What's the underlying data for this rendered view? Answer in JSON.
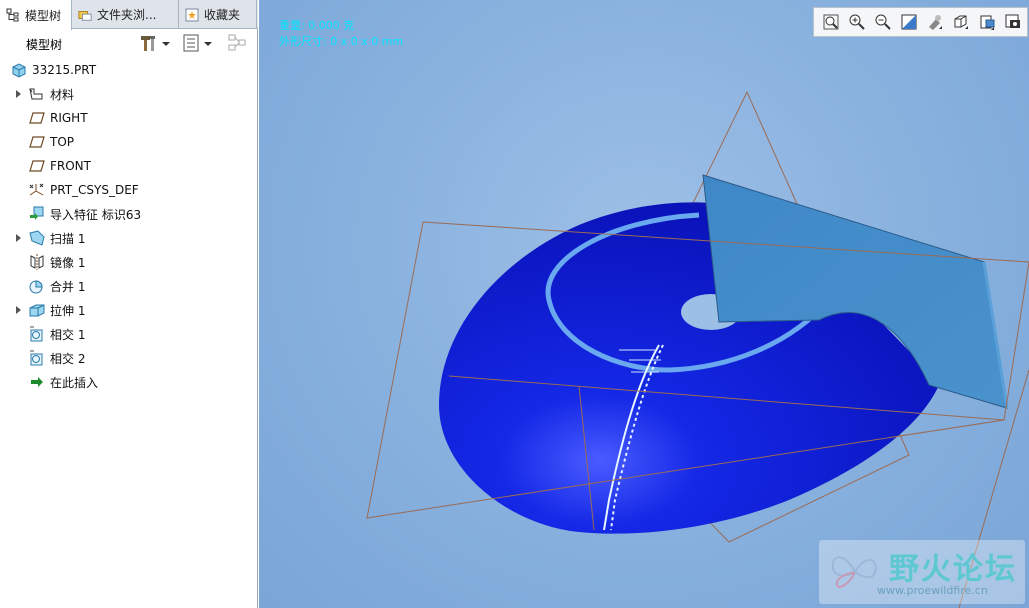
{
  "tabs": [
    {
      "label": "模型树",
      "icon": "tree-icon"
    },
    {
      "label": "文件夹浏...",
      "icon": "folder-browser-icon"
    },
    {
      "label": "收藏夹",
      "icon": "favorites-icon"
    }
  ],
  "tree_toolbar": {
    "title": "模型树"
  },
  "tree": {
    "root": {
      "label": "33215.PRT",
      "icon": "part-icon"
    },
    "items": [
      {
        "label": "材料",
        "icon": "material-icon",
        "expandable": true
      },
      {
        "label": "RIGHT",
        "icon": "datum-plane-icon",
        "expandable": false
      },
      {
        "label": "TOP",
        "icon": "datum-plane-icon",
        "expandable": false
      },
      {
        "label": "FRONT",
        "icon": "datum-plane-icon",
        "expandable": false
      },
      {
        "label": "PRT_CSYS_DEF",
        "icon": "csys-icon",
        "expandable": false
      },
      {
        "label": "导入特征 标识63",
        "icon": "import-feature-icon",
        "expandable": false
      },
      {
        "label": "扫描 1",
        "icon": "sweep-icon",
        "expandable": true
      },
      {
        "label": "镜像 1",
        "icon": "mirror-icon",
        "expandable": false
      },
      {
        "label": "合并 1",
        "icon": "merge-icon",
        "expandable": false
      },
      {
        "label": "拉伸 1",
        "icon": "extrude-icon",
        "expandable": true
      },
      {
        "label": "相交 1",
        "icon": "intersect-icon",
        "expandable": false
      },
      {
        "label": "相交 2",
        "icon": "intersect-icon",
        "expandable": false
      },
      {
        "label": "在此插入",
        "icon": "insert-here-icon",
        "expandable": false
      }
    ]
  },
  "viewport": {
    "info_line_1": "重量: 0.000 克",
    "info_line_2": "外形尺寸: 0 x 0 x 0 mm",
    "toolbar_icons": [
      "zoom-fit-icon",
      "zoom-in-icon",
      "zoom-out-icon",
      "repaint-icon",
      "display-style-icon",
      "saved-views-icon",
      "datum-display-icon",
      "spin-center-icon"
    ]
  },
  "watermark": {
    "title": "野火论坛",
    "url": "www.proewildfire.cn"
  },
  "colors": {
    "model_blue": "#0a14d6",
    "plane_blue": "#3d86c4",
    "datum_line": "#9b6b55",
    "info_text": "#00e5ff"
  }
}
